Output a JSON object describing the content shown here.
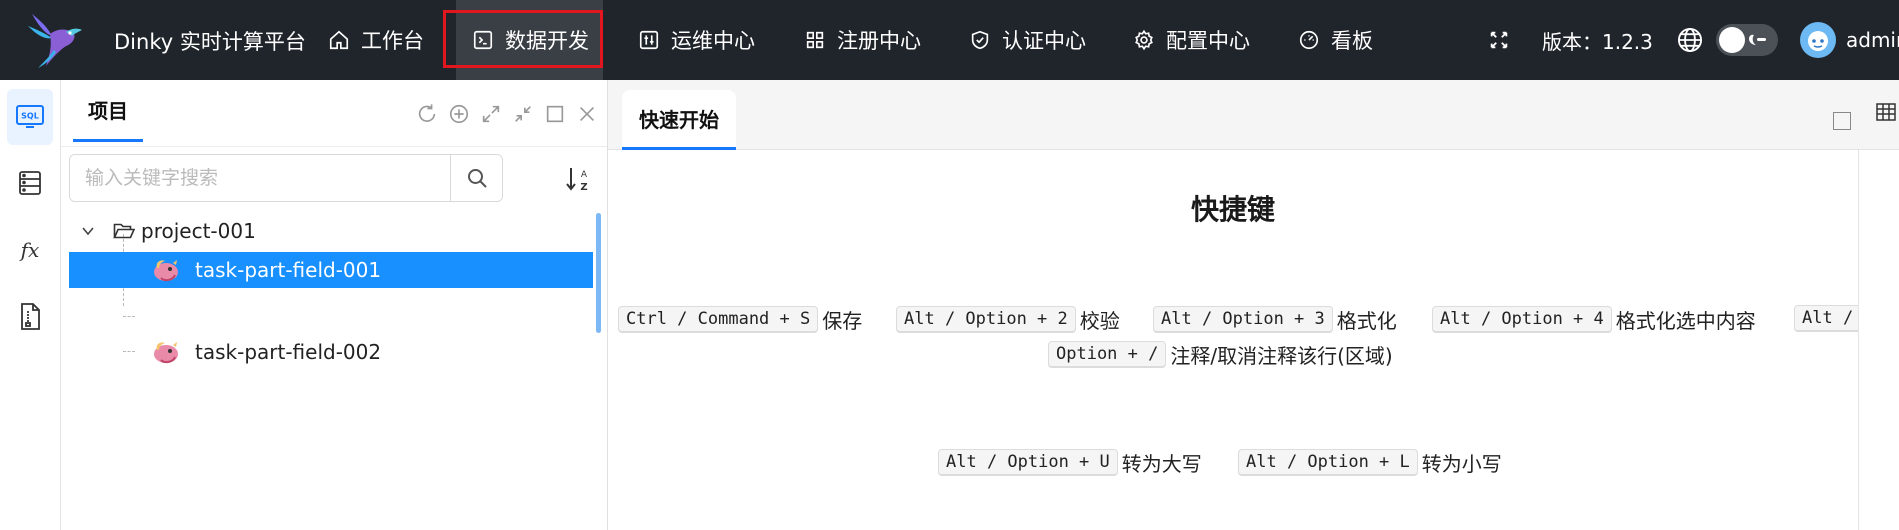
{
  "header": {
    "brand": "Dinky 实时计算平台",
    "nav": [
      {
        "label": "工作台",
        "icon": "home-icon"
      },
      {
        "label": "数据开发",
        "icon": "terminal-icon"
      },
      {
        "label": "运维中心",
        "icon": "sliders-icon"
      },
      {
        "label": "注册中心",
        "icon": "grid-icon"
      },
      {
        "label": "认证中心",
        "icon": "shield-icon"
      },
      {
        "label": "配置中心",
        "icon": "gear-icon"
      },
      {
        "label": "看板",
        "icon": "dashboard-icon"
      }
    ],
    "active_nav": "数据开发",
    "version": "版本：1.2.3",
    "username": "admin",
    "highlight_color": "#e2161f",
    "bg_color": "#20252b"
  },
  "sidebar": {
    "items": [
      {
        "icon": "sql-icon",
        "active": true
      },
      {
        "icon": "database-icon",
        "active": false
      },
      {
        "icon": "function-icon",
        "active": false
      },
      {
        "icon": "document-icon",
        "active": false
      }
    ]
  },
  "project": {
    "tab_label": "项目",
    "search_placeholder": "输入关键字搜索",
    "tree": {
      "folder": "project-001",
      "tasks": [
        {
          "name": "task-part-field-001",
          "selected": true
        },
        {
          "name": "task-part-field-002",
          "selected": false
        }
      ]
    },
    "selected_color": "#1890ff"
  },
  "editor": {
    "tab_label": "快速开始",
    "hotkeys_title": "快捷键",
    "hotkeys_row1": [
      {
        "key": "Ctrl / Command + S",
        "desc": "保存"
      },
      {
        "key": "Alt / Option + 2",
        "desc": "校验"
      },
      {
        "key": "Alt / Option + 3",
        "desc": "格式化"
      },
      {
        "key": "Alt / Option + 4",
        "desc": "格式化选中内容"
      },
      {
        "key": "Alt /",
        "desc": ""
      }
    ],
    "hotkeys_row2": {
      "key": "Option + /",
      "desc": "注释/取消注释该行(区域)"
    },
    "hotkeys_row3": [
      {
        "key": "Alt / Option + U",
        "desc": "转为大写"
      },
      {
        "key": "Alt / Option + L",
        "desc": "转为小写"
      }
    ]
  }
}
